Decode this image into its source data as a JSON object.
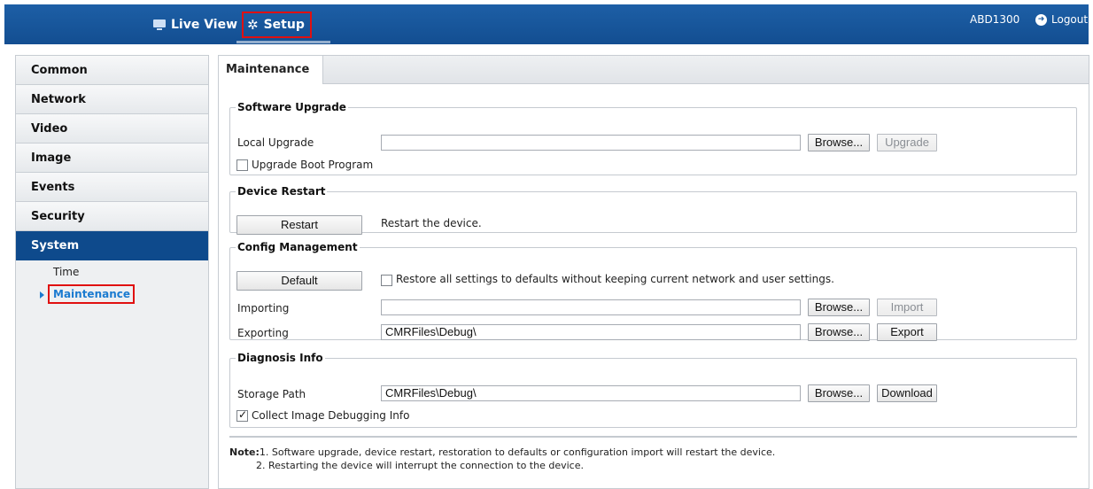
{
  "header": {
    "live_view_label": "Live View",
    "setup_label": "Setup",
    "user": "ABD1300",
    "logout_label": "Logout"
  },
  "sidebar": {
    "items": [
      {
        "label": "Common"
      },
      {
        "label": "Network"
      },
      {
        "label": "Video"
      },
      {
        "label": "Image"
      },
      {
        "label": "Events"
      },
      {
        "label": "Security"
      },
      {
        "label": "System"
      }
    ],
    "subitems": [
      {
        "label": "Time"
      },
      {
        "label": "Maintenance"
      }
    ]
  },
  "main": {
    "tab_label": "Maintenance",
    "software_upgrade": {
      "legend": "Software Upgrade",
      "local_upgrade_label": "Local Upgrade",
      "local_upgrade_value": "",
      "browse_label": "Browse...",
      "upgrade_label": "Upgrade",
      "boot_program_label": "Upgrade Boot Program",
      "boot_program_checked": false
    },
    "device_restart": {
      "legend": "Device Restart",
      "restart_label": "Restart",
      "restart_desc": "Restart the device."
    },
    "config_management": {
      "legend": "Config Management",
      "default_label": "Default",
      "restore_label": "Restore all settings to defaults without keeping current network and user settings.",
      "restore_checked": false,
      "importing_label": "Importing",
      "importing_value": "",
      "import_browse_label": "Browse...",
      "import_label": "Import",
      "exporting_label": "Exporting",
      "exporting_value": "CMRFiles\\Debug\\",
      "export_browse_label": "Browse...",
      "export_label": "Export"
    },
    "diagnosis_info": {
      "legend": "Diagnosis Info",
      "storage_path_label": "Storage Path",
      "storage_path_value": "CMRFiles\\Debug\\",
      "browse_label": "Browse...",
      "download_label": "Download",
      "collect_label": "Collect Image Debugging Info",
      "collect_checked": true
    },
    "note": {
      "prefix": "Note:",
      "line1": "1. Software upgrade, device restart, restoration to defaults or configuration import will restart the device.",
      "line2": "2. Restarting the device will interrupt the connection to the device."
    }
  },
  "colors": {
    "header_bg": "#1a5aa0",
    "sidebar_active_bg": "#0e4a8c",
    "highlight_red": "#e01010",
    "link_blue": "#1b7bd0"
  },
  "icons": {
    "live_view": "monitor-icon",
    "setup": "gear-icon",
    "logout": "arrow-circle-right-icon"
  }
}
